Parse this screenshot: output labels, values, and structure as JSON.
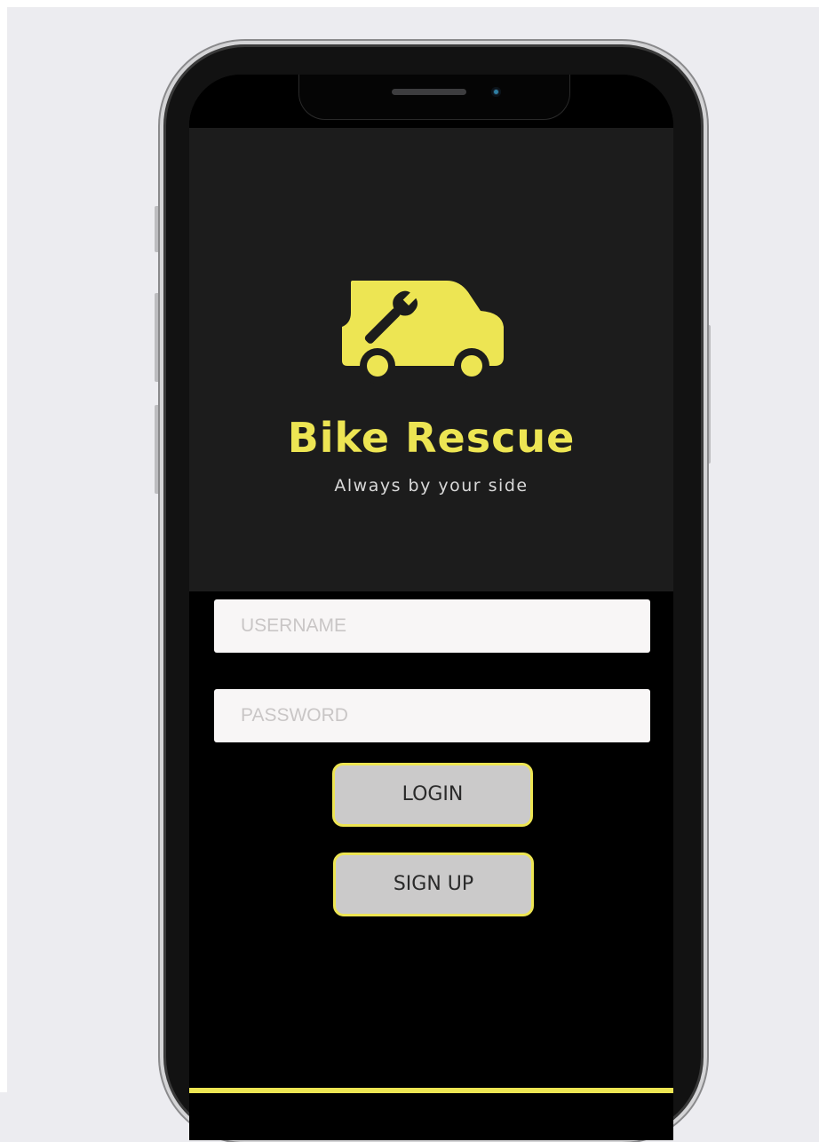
{
  "app": {
    "brand_name": "Bike Rescue",
    "tagline": "Always by your side",
    "logo_icon": "van-wrench-icon"
  },
  "form": {
    "username_placeholder": "USERNAME",
    "password_placeholder": "PASSWORD",
    "login_label": "LOGIN",
    "signup_label": "SIGN UP"
  },
  "colors": {
    "accent": "#ede553",
    "hero_background": "#1c1c1c",
    "screen_background": "#000000",
    "button_background": "#cbcaca",
    "input_background": "#f8f6f6"
  }
}
